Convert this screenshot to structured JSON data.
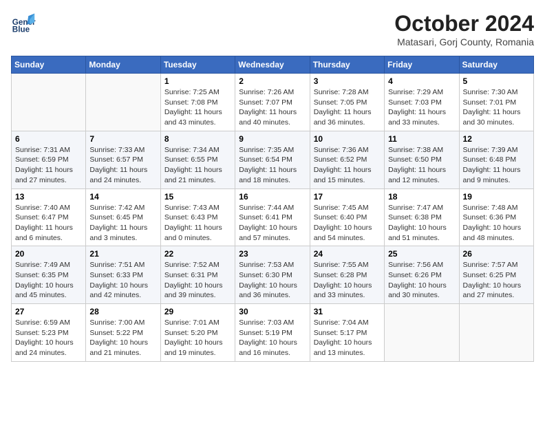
{
  "header": {
    "logo_line1": "General",
    "logo_line2": "Blue",
    "title": "October 2024",
    "subtitle": "Matasari, Gorj County, Romania"
  },
  "weekdays": [
    "Sunday",
    "Monday",
    "Tuesday",
    "Wednesday",
    "Thursday",
    "Friday",
    "Saturday"
  ],
  "weeks": [
    [
      {
        "day": "",
        "info": ""
      },
      {
        "day": "",
        "info": ""
      },
      {
        "day": "1",
        "info": "Sunrise: 7:25 AM\nSunset: 7:08 PM\nDaylight: 11 hours and 43 minutes."
      },
      {
        "day": "2",
        "info": "Sunrise: 7:26 AM\nSunset: 7:07 PM\nDaylight: 11 hours and 40 minutes."
      },
      {
        "day": "3",
        "info": "Sunrise: 7:28 AM\nSunset: 7:05 PM\nDaylight: 11 hours and 36 minutes."
      },
      {
        "day": "4",
        "info": "Sunrise: 7:29 AM\nSunset: 7:03 PM\nDaylight: 11 hours and 33 minutes."
      },
      {
        "day": "5",
        "info": "Sunrise: 7:30 AM\nSunset: 7:01 PM\nDaylight: 11 hours and 30 minutes."
      }
    ],
    [
      {
        "day": "6",
        "info": "Sunrise: 7:31 AM\nSunset: 6:59 PM\nDaylight: 11 hours and 27 minutes."
      },
      {
        "day": "7",
        "info": "Sunrise: 7:33 AM\nSunset: 6:57 PM\nDaylight: 11 hours and 24 minutes."
      },
      {
        "day": "8",
        "info": "Sunrise: 7:34 AM\nSunset: 6:55 PM\nDaylight: 11 hours and 21 minutes."
      },
      {
        "day": "9",
        "info": "Sunrise: 7:35 AM\nSunset: 6:54 PM\nDaylight: 11 hours and 18 minutes."
      },
      {
        "day": "10",
        "info": "Sunrise: 7:36 AM\nSunset: 6:52 PM\nDaylight: 11 hours and 15 minutes."
      },
      {
        "day": "11",
        "info": "Sunrise: 7:38 AM\nSunset: 6:50 PM\nDaylight: 11 hours and 12 minutes."
      },
      {
        "day": "12",
        "info": "Sunrise: 7:39 AM\nSunset: 6:48 PM\nDaylight: 11 hours and 9 minutes."
      }
    ],
    [
      {
        "day": "13",
        "info": "Sunrise: 7:40 AM\nSunset: 6:47 PM\nDaylight: 11 hours and 6 minutes."
      },
      {
        "day": "14",
        "info": "Sunrise: 7:42 AM\nSunset: 6:45 PM\nDaylight: 11 hours and 3 minutes."
      },
      {
        "day": "15",
        "info": "Sunrise: 7:43 AM\nSunset: 6:43 PM\nDaylight: 11 hours and 0 minutes."
      },
      {
        "day": "16",
        "info": "Sunrise: 7:44 AM\nSunset: 6:41 PM\nDaylight: 10 hours and 57 minutes."
      },
      {
        "day": "17",
        "info": "Sunrise: 7:45 AM\nSunset: 6:40 PM\nDaylight: 10 hours and 54 minutes."
      },
      {
        "day": "18",
        "info": "Sunrise: 7:47 AM\nSunset: 6:38 PM\nDaylight: 10 hours and 51 minutes."
      },
      {
        "day": "19",
        "info": "Sunrise: 7:48 AM\nSunset: 6:36 PM\nDaylight: 10 hours and 48 minutes."
      }
    ],
    [
      {
        "day": "20",
        "info": "Sunrise: 7:49 AM\nSunset: 6:35 PM\nDaylight: 10 hours and 45 minutes."
      },
      {
        "day": "21",
        "info": "Sunrise: 7:51 AM\nSunset: 6:33 PM\nDaylight: 10 hours and 42 minutes."
      },
      {
        "day": "22",
        "info": "Sunrise: 7:52 AM\nSunset: 6:31 PM\nDaylight: 10 hours and 39 minutes."
      },
      {
        "day": "23",
        "info": "Sunrise: 7:53 AM\nSunset: 6:30 PM\nDaylight: 10 hours and 36 minutes."
      },
      {
        "day": "24",
        "info": "Sunrise: 7:55 AM\nSunset: 6:28 PM\nDaylight: 10 hours and 33 minutes."
      },
      {
        "day": "25",
        "info": "Sunrise: 7:56 AM\nSunset: 6:26 PM\nDaylight: 10 hours and 30 minutes."
      },
      {
        "day": "26",
        "info": "Sunrise: 7:57 AM\nSunset: 6:25 PM\nDaylight: 10 hours and 27 minutes."
      }
    ],
    [
      {
        "day": "27",
        "info": "Sunrise: 6:59 AM\nSunset: 5:23 PM\nDaylight: 10 hours and 24 minutes."
      },
      {
        "day": "28",
        "info": "Sunrise: 7:00 AM\nSunset: 5:22 PM\nDaylight: 10 hours and 21 minutes."
      },
      {
        "day": "29",
        "info": "Sunrise: 7:01 AM\nSunset: 5:20 PM\nDaylight: 10 hours and 19 minutes."
      },
      {
        "day": "30",
        "info": "Sunrise: 7:03 AM\nSunset: 5:19 PM\nDaylight: 10 hours and 16 minutes."
      },
      {
        "day": "31",
        "info": "Sunrise: 7:04 AM\nSunset: 5:17 PM\nDaylight: 10 hours and 13 minutes."
      },
      {
        "day": "",
        "info": ""
      },
      {
        "day": "",
        "info": ""
      }
    ]
  ]
}
